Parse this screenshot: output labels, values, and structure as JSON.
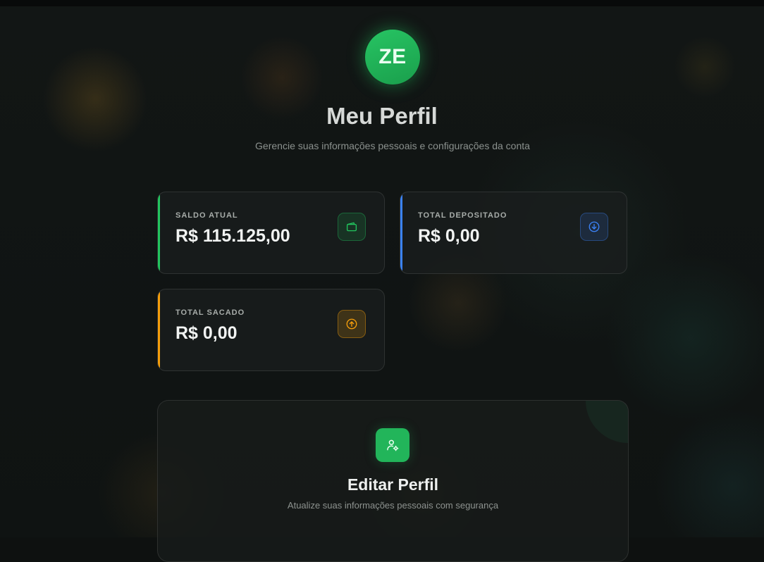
{
  "profile": {
    "initials": "ZE",
    "title": "Meu Perfil",
    "subtitle": "Gerencie suas informações pessoais e configurações da conta"
  },
  "stats": [
    {
      "label": "SALDO ATUAL",
      "value": "R$ 115.125,00",
      "icon": "wallet-icon",
      "color": "#22c55e"
    },
    {
      "label": "TOTAL DEPOSITADO",
      "value": "R$ 0,00",
      "icon": "arrow-down-circle-icon",
      "color": "#3b82f6"
    },
    {
      "label": "TOTAL SACADO",
      "value": "R$ 0,00",
      "icon": "arrow-up-circle-icon",
      "color": "#f59e0b"
    }
  ],
  "edit": {
    "title": "Editar Perfil",
    "subtitle": "Atualize suas informações pessoais com segurança",
    "icon": "user-settings-icon"
  }
}
